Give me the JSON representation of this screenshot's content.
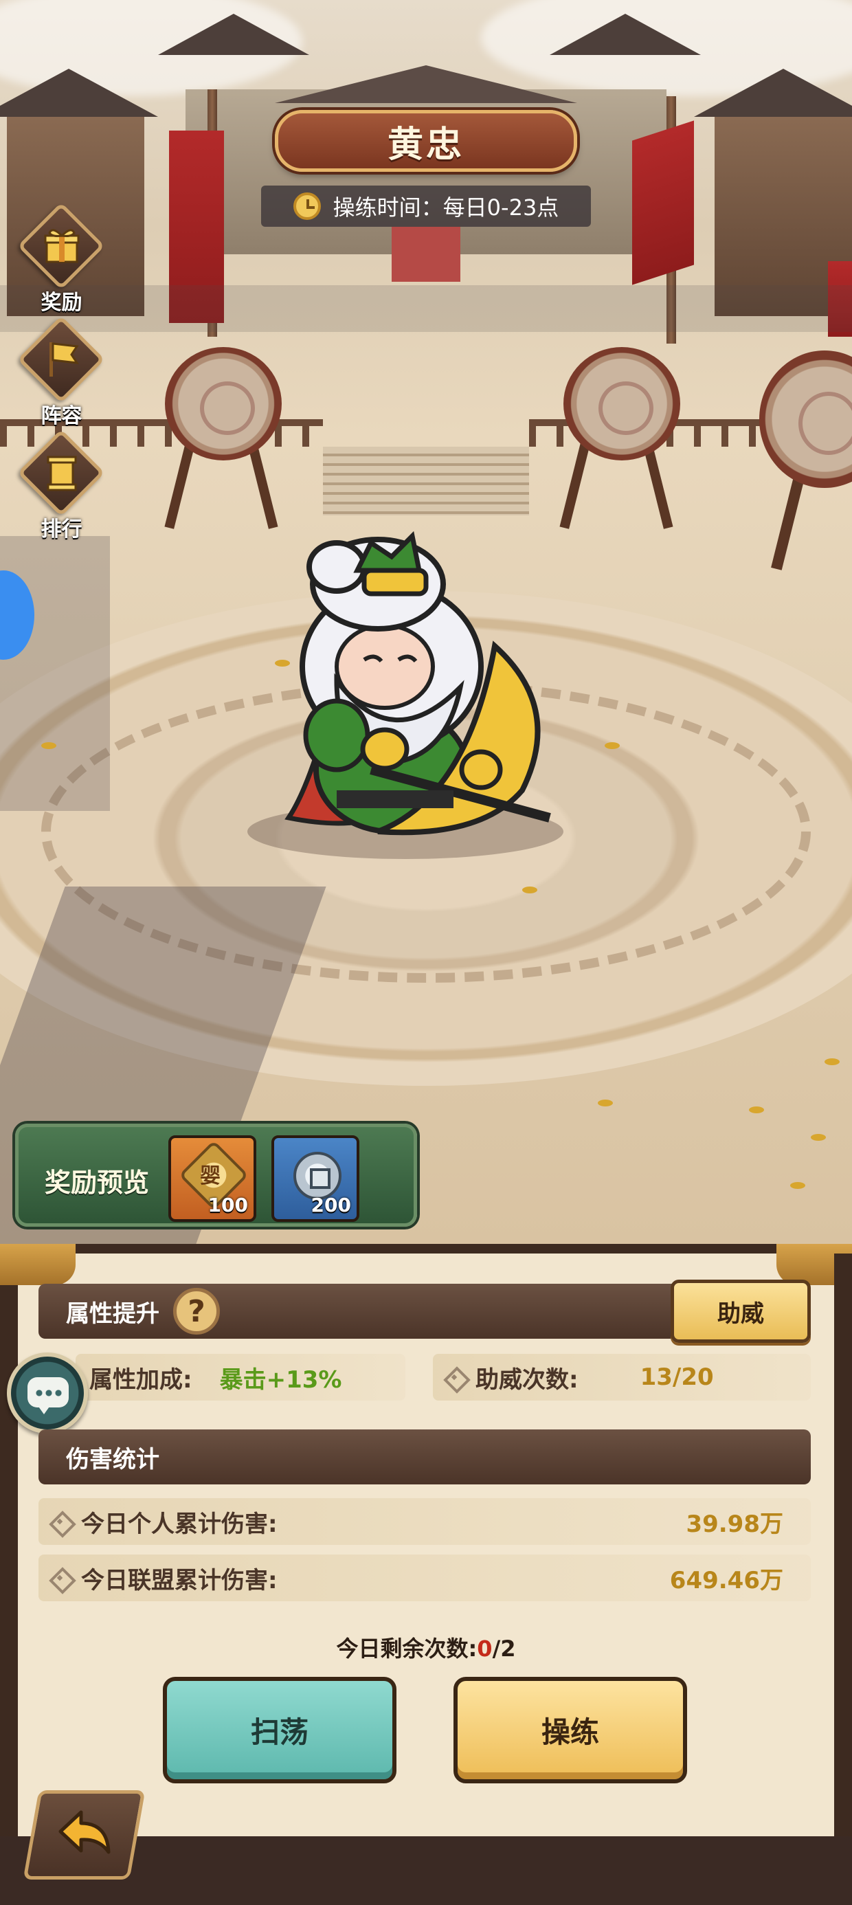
{
  "header": {
    "hero_name": "黄忠",
    "training_time": "操练时间：每日0-23点"
  },
  "side_menu": [
    {
      "label": "奖励",
      "icon": "gift-icon"
    },
    {
      "label": "阵容",
      "icon": "flag-icon"
    },
    {
      "label": "排行",
      "icon": "ranking-icon"
    }
  ],
  "reward_preview": {
    "label": "奖励预览",
    "items": [
      {
        "icon": "medal-icon",
        "glyph": "婴",
        "count": "100"
      },
      {
        "icon": "silver-coin-icon",
        "count": "200"
      }
    ]
  },
  "attribute_section": {
    "title": "属性提升",
    "help_glyph": "?",
    "cheer_button": "助威",
    "bonus_label": "属性加成:",
    "bonus_value": "暴击+13%",
    "cheer_count_label": "助威次数:",
    "cheer_count_value": "13/20"
  },
  "damage_section": {
    "title": "伤害统计",
    "rows": [
      {
        "label": "今日个人累计伤害:",
        "value": "39.98万"
      },
      {
        "label": "今日联盟累计伤害:",
        "value": "649.46万"
      }
    ]
  },
  "remaining": {
    "label": "今日剩余次数:",
    "used": "0",
    "total": "/2"
  },
  "actions": {
    "sweep": "扫荡",
    "train": "操练"
  },
  "colors": {
    "bonus_value": "#5a9a1a",
    "cheer_count": "#b8861a",
    "damage_value": "#b8861a",
    "remaining_zero": "#c42a1a",
    "sweep_button": "#7fcfc4",
    "train_button": "#f5cd6a"
  }
}
